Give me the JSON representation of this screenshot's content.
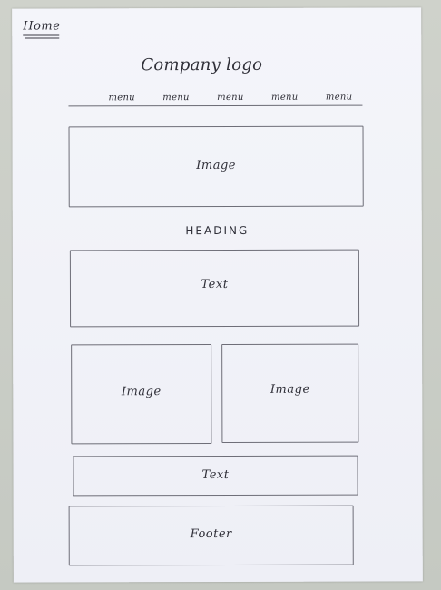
{
  "nav": {
    "home_label": "Home"
  },
  "header": {
    "logo_text": "Company logo",
    "menu_items": [
      "menu",
      "menu",
      "menu",
      "menu",
      "menu"
    ]
  },
  "hero": {
    "label": "Image"
  },
  "section": {
    "heading": "HEADING",
    "text_label": "Text"
  },
  "gallery": {
    "left_label": "Image",
    "right_label": "Image"
  },
  "caption": {
    "text_label": "Text"
  },
  "footer": {
    "label": "Footer"
  },
  "colors": {
    "paper": "#f1f2f8",
    "ink": "#2f2f38",
    "background": "#c9cdc6"
  }
}
